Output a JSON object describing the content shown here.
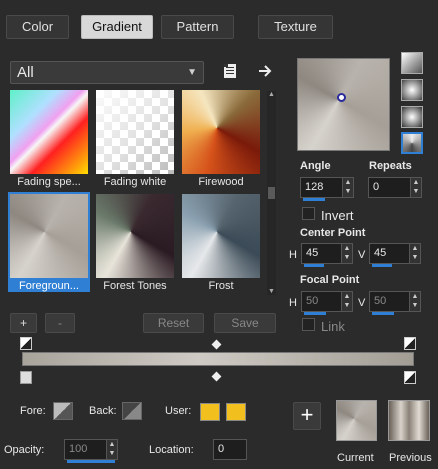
{
  "tabs": [
    {
      "label": "Color"
    },
    {
      "label": "Gradient"
    },
    {
      "label": "Pattern"
    },
    {
      "label": "Texture"
    }
  ],
  "category": {
    "value": "All"
  },
  "gradients": [
    {
      "label": "Fading spe..."
    },
    {
      "label": "Fading white"
    },
    {
      "label": "Firewood"
    },
    {
      "label": "Foregroun..."
    },
    {
      "label": "Forest Tones"
    },
    {
      "label": "Frost"
    }
  ],
  "buttons": {
    "add": "+",
    "remove": "-",
    "reset": "Reset",
    "save": "Save"
  },
  "settings": {
    "angle_label": "Angle",
    "angle_value": "128",
    "repeats_label": "Repeats",
    "repeats_value": "0",
    "invert_label": "Invert",
    "center_label": "Center Point",
    "h_label": "H",
    "v_label": "V",
    "center_h": "45",
    "center_v": "45",
    "focal_label": "Focal Point",
    "focal_h": "50",
    "focal_v": "50",
    "link_label": "Link"
  },
  "bottom": {
    "fore_label": "Fore:",
    "back_label": "Back:",
    "user_label": "User:",
    "opacity_label": "Opacity:",
    "opacity_value": "100",
    "location_label": "Location:",
    "location_value": "0",
    "add_symbol": "+",
    "current_label": "Current",
    "previous_label": "Previous"
  },
  "colors": {
    "accent": "#2f7fd4",
    "user_color": "#f2c01e"
  }
}
